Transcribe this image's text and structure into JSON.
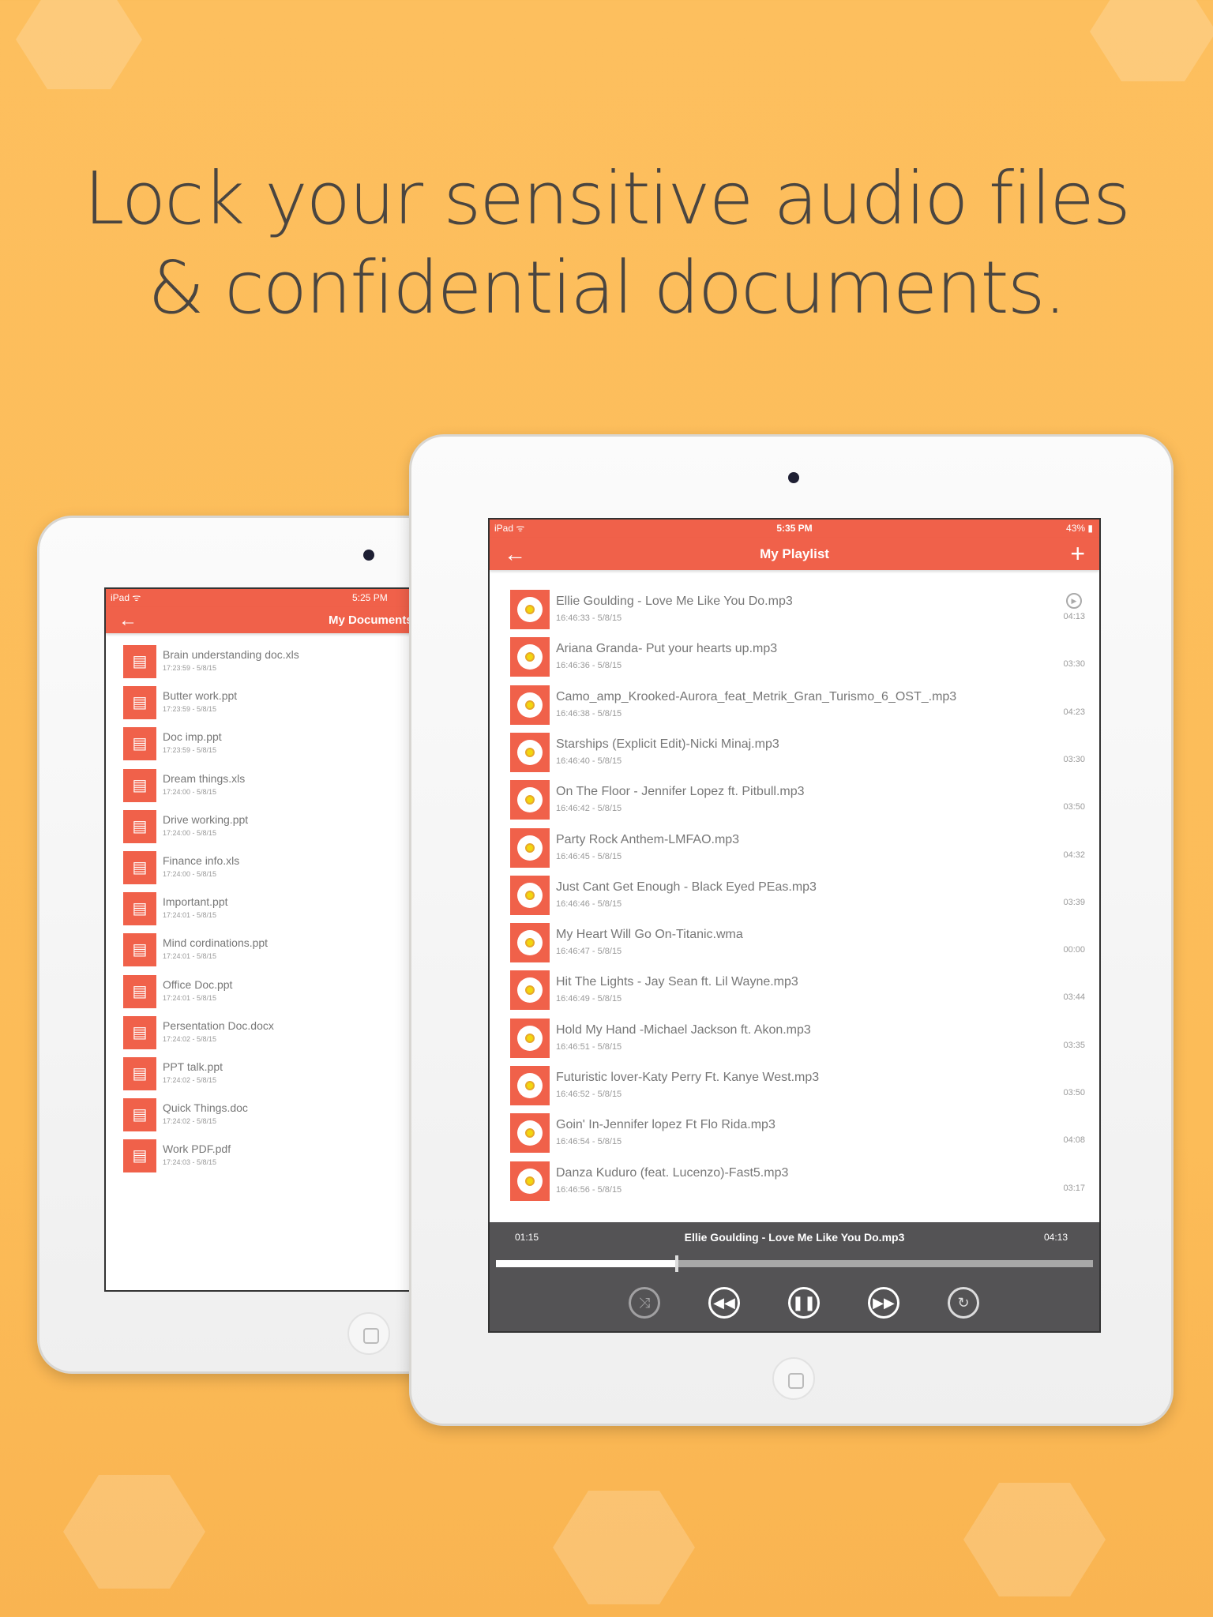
{
  "headline": {
    "line1": "Lock your sensitive audio files",
    "line2": "& confidential documents."
  },
  "colors": {
    "background": "#fdbf5e",
    "accent": "#f0614a",
    "player": "#545355"
  },
  "documents_screen": {
    "status": {
      "carrier": "iPad",
      "time": "5:25 PM"
    },
    "nav": {
      "title": "My Documents",
      "back_icon": "arrow-left-icon"
    },
    "items": [
      {
        "name": "Brain understanding doc.xls",
        "meta": "17:23:59 - 5/8/15"
      },
      {
        "name": "Butter work.ppt",
        "meta": "17:23:59 - 5/8/15"
      },
      {
        "name": "Doc imp.ppt",
        "meta": "17:23:59 - 5/8/15"
      },
      {
        "name": "Dream things.xls",
        "meta": "17:24:00 - 5/8/15"
      },
      {
        "name": "Drive working.ppt",
        "meta": "17:24:00 - 5/8/15"
      },
      {
        "name": "Finance info.xls",
        "meta": "17:24:00 - 5/8/15"
      },
      {
        "name": "Important.ppt",
        "meta": "17:24:01 - 5/8/15"
      },
      {
        "name": "Mind cordinations.ppt",
        "meta": "17:24:01 - 5/8/15"
      },
      {
        "name": "Office Doc.ppt",
        "meta": "17:24:01 - 5/8/15"
      },
      {
        "name": "Persentation Doc.docx",
        "meta": "17:24:02 - 5/8/15"
      },
      {
        "name": "PPT talk.ppt",
        "meta": "17:24:02 - 5/8/15"
      },
      {
        "name": "Quick Things.doc",
        "meta": "17:24:02 - 5/8/15"
      },
      {
        "name": "Work PDF.pdf",
        "meta": "17:24:03 - 5/8/15"
      }
    ]
  },
  "playlist_screen": {
    "status": {
      "carrier": "iPad",
      "time": "5:35 PM",
      "battery": "43%"
    },
    "nav": {
      "title": "My Playlist",
      "back_icon": "arrow-left-icon",
      "add_icon": "plus-icon"
    },
    "tracks": [
      {
        "name": "Ellie Goulding - Love Me Like You Do.mp3",
        "meta": "16:46:33 - 5/8/15",
        "duration": "04:13",
        "playing": true
      },
      {
        "name": "Ariana Granda- Put your hearts up.mp3",
        "meta": "16:46:36 - 5/8/15",
        "duration": "03:30"
      },
      {
        "name": "Camo_amp_Krooked-Aurora_feat_Metrik_Gran_Turismo_6_OST_.mp3",
        "meta": "16:46:38 - 5/8/15",
        "duration": "04:23"
      },
      {
        "name": "Starships (Explicit Edit)-Nicki Minaj.mp3",
        "meta": "16:46:40 - 5/8/15",
        "duration": "03:30"
      },
      {
        "name": "On The Floor - Jennifer Lopez ft. Pitbull.mp3",
        "meta": "16:46:42 - 5/8/15",
        "duration": "03:50"
      },
      {
        "name": "Party Rock Anthem-LMFAO.mp3",
        "meta": "16:46:45 - 5/8/15",
        "duration": "04:32"
      },
      {
        "name": "Just Cant Get Enough - Black Eyed PEas.mp3",
        "meta": "16:46:46 - 5/8/15",
        "duration": "03:39"
      },
      {
        "name": "My Heart Will Go On-Titanic.wma",
        "meta": "16:46:47 - 5/8/15",
        "duration": "00:00"
      },
      {
        "name": "Hit The Lights - Jay Sean ft. Lil Wayne.mp3",
        "meta": "16:46:49 - 5/8/15",
        "duration": "03:44"
      },
      {
        "name": "Hold My Hand -Michael Jackson ft. Akon.mp3",
        "meta": "16:46:51 - 5/8/15",
        "duration": "03:35"
      },
      {
        "name": "Futuristic lover-Katy Perry Ft. Kanye West.mp3",
        "meta": "16:46:52 - 5/8/15",
        "duration": "03:50"
      },
      {
        "name": "Goin' In-Jennifer lopez Ft Flo Rida.mp3",
        "meta": "16:46:54 - 5/8/15",
        "duration": "04:08"
      },
      {
        "name": "Danza Kuduro (feat. Lucenzo)-Fast5.mp3",
        "meta": "16:46:56 - 5/8/15",
        "duration": "03:17"
      }
    ],
    "player": {
      "elapsed": "01:15",
      "track": "Ellie Goulding - Love Me Like You Do.mp3",
      "total": "04:13",
      "progress_percent": 30,
      "controls": [
        "shuffle-icon",
        "rewind-icon",
        "pause-icon",
        "fast-forward-icon",
        "repeat-icon"
      ]
    }
  }
}
